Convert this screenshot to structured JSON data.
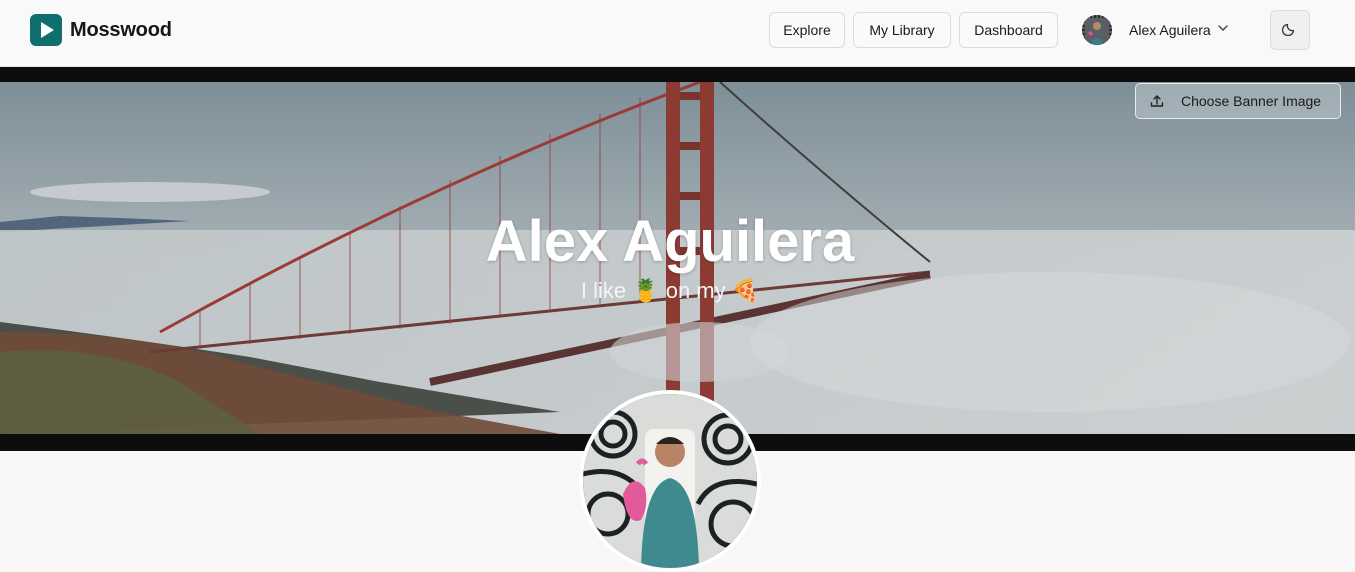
{
  "brand": {
    "name": "Mosswood",
    "accent": "#0f6e6e"
  },
  "nav": {
    "explore": "Explore",
    "library": "My Library",
    "dashboard": "Dashboard"
  },
  "user": {
    "name": "Alex Aguilera"
  },
  "banner": {
    "choose_label": "Choose Banner Image"
  },
  "profile": {
    "name": "Alex Aguilera",
    "bio": "I like 🍍 on my 🍕"
  },
  "icons": [
    "play-logo-icon",
    "chevron-down-icon",
    "moon-icon",
    "upload-icon"
  ]
}
